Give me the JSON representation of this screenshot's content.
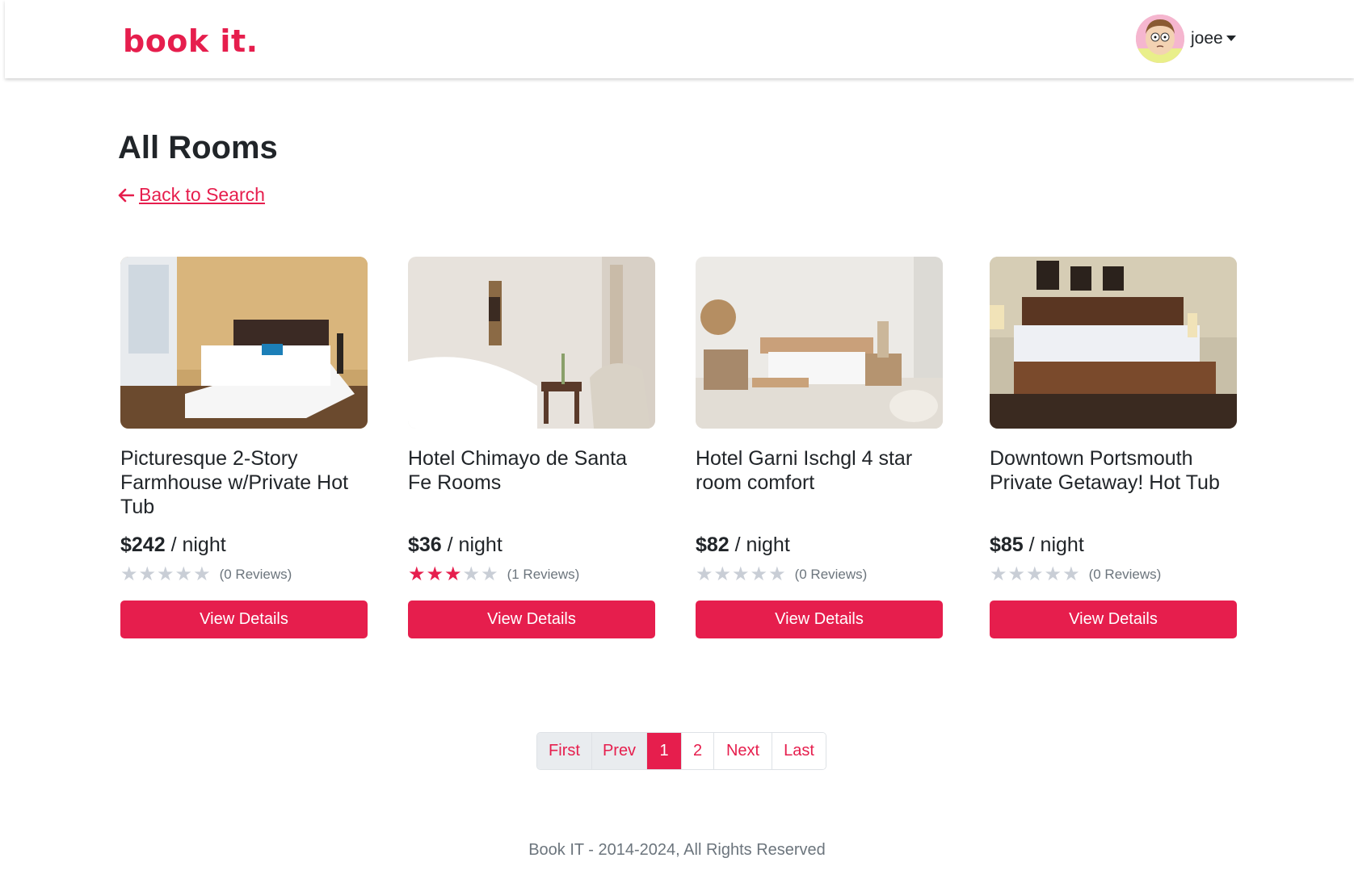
{
  "brand": {
    "logo_text": "book it.",
    "accent": "#e61e4d"
  },
  "user": {
    "name": "joee",
    "avatar": "user-avatar"
  },
  "page": {
    "title": "All Rooms",
    "back_link": "Back to Search"
  },
  "rooms": [
    {
      "name": "Picturesque 2-Story Farmhouse w/Private Hot Tub",
      "price": "$242",
      "per": " / night",
      "rating": 0,
      "max_rating": 5,
      "reviews": "(0 Reviews)",
      "button": "View Details"
    },
    {
      "name": "Hotel Chimayo de Santa Fe Rooms",
      "price": "$36",
      "per": " / night",
      "rating": 3,
      "max_rating": 5,
      "reviews": "(1 Reviews)",
      "button": "View Details"
    },
    {
      "name": "Hotel Garni Ischgl 4 star room comfort",
      "price": "$82",
      "per": " / night",
      "rating": 0,
      "max_rating": 5,
      "reviews": "(0 Reviews)",
      "button": "View Details"
    },
    {
      "name": "Downtown Portsmouth Private Getaway! Hot Tub",
      "price": "$85",
      "per": " / night",
      "rating": 0,
      "max_rating": 5,
      "reviews": "(0 Reviews)",
      "button": "View Details"
    }
  ],
  "pagination": {
    "first": "First",
    "prev": "Prev",
    "pages": [
      "1",
      "2"
    ],
    "current": "1",
    "next": "Next",
    "last": "Last"
  },
  "footer": {
    "text": "Book IT - 2014-2024, All Rights Reserved"
  }
}
